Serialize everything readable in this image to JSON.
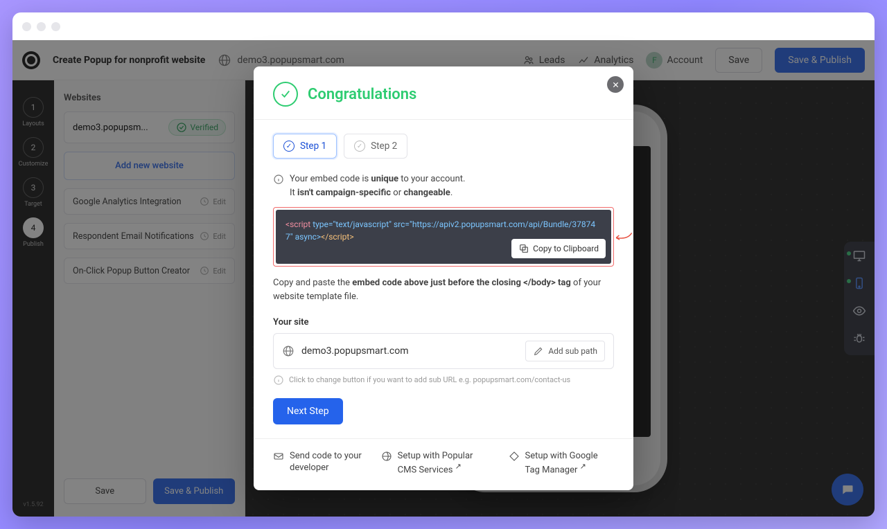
{
  "topbar": {
    "page_title": "Create Popup for nonprofit website",
    "domain": "demo3.popupsmart.com",
    "leads": "Leads",
    "analytics": "Analytics",
    "account_initial": "F",
    "account": "Account",
    "save": "Save",
    "save_publish": "Save & Publish"
  },
  "sidenav": {
    "steps": [
      {
        "num": "1",
        "label": "Layouts"
      },
      {
        "num": "2",
        "label": "Customize"
      },
      {
        "num": "3",
        "label": "Target"
      },
      {
        "num": "4",
        "label": "Publish"
      }
    ],
    "version": "v1.5.92"
  },
  "panel": {
    "heading": "Websites",
    "site_short": "demo3.popupsm...",
    "verified": "Verified",
    "add_new": "Add new website",
    "rows": [
      "Google Analytics Integration",
      "Respondent Email Notifications",
      "On-Click Popup Button Creator"
    ],
    "edit": "Edit",
    "footer_save": "Save",
    "footer_publish": "Save & Publish"
  },
  "modal": {
    "title": "Congratulations",
    "step1": "Step 1",
    "step2": "Step 2",
    "line1_a": "Your embed code is ",
    "line1_b": "unique",
    "line1_c": " to your account.",
    "line2_a": "It ",
    "line2_b": "isn't campaign-specific",
    "line2_c": " or ",
    "line2_d": "changeable",
    "line2_e": ".",
    "code_open": "<script ",
    "code_attrs": "type=\"text/javascript\" src=\"https://apiv2.popupsmart.com/api/Bundle/378747\" async>",
    "code_close": "</script>",
    "copy": "Copy to Clipboard",
    "help_a": "Copy and paste the ",
    "help_b": "embed code above just before the closing </body> tag",
    "help_c": " of your website template file.",
    "your_site": "Your site",
    "site_value": "demo3.popupsmart.com",
    "add_sub": "Add sub path",
    "hint": "Click to change button if you want to add sub URL e.g. popupsmart.com/contact-us",
    "next": "Next Step",
    "foot1": "Send code to your developer",
    "foot2": "Setup with Popular CMS Services",
    "foot3": "Setup with Google Tag Manager"
  }
}
